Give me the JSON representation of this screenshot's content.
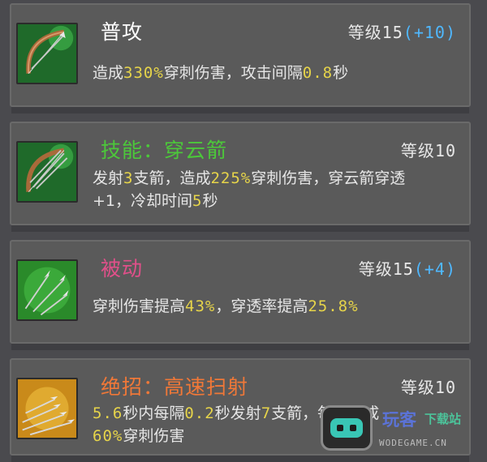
{
  "colors": {
    "card_bg": "#5a5a5a",
    "highlight_yellow": "#e6d44a",
    "bonus_blue": "#4fb8ff",
    "title_white": "#ffffff",
    "title_green": "#4cc83a",
    "title_pink": "#e0508a",
    "title_orange": "#f07838"
  },
  "skills": [
    {
      "icon": "bow-icon",
      "title": "普攻",
      "level_label": "等级15",
      "level_bonus": "(+10)",
      "desc": {
        "t1": "造成",
        "v1": "330%",
        "t2": "穿刺伤害，攻击间隔",
        "v2": "0.8",
        "t3": "秒"
      }
    },
    {
      "icon": "bow-icon",
      "title": "技能：穿云箭",
      "level_label": "等级10",
      "desc": {
        "t1": "发射",
        "v1": "3",
        "t2": "支箭，造成",
        "v2": "225%",
        "t3": "穿刺伤害，穿云箭穿透",
        "t4": "+1，冷却时间",
        "v3": "5",
        "t5": "秒"
      }
    },
    {
      "icon": "arrows-icon",
      "title": "被动",
      "level_label": "等级15",
      "level_bonus": "(+4)",
      "desc": {
        "t1": "穿刺伤害提高",
        "v1": "43%",
        "t2": "，穿透率提高",
        "v2": "25.8%"
      }
    },
    {
      "icon": "arrow-volley-icon",
      "title": "绝招：高速扫射",
      "level_label": "等级10",
      "desc": {
        "v1": "5.6",
        "t1": "秒内每隔",
        "v2": "0.2",
        "t2": "秒发射",
        "v3": "7",
        "t3": "支箭，每支造成",
        "v4": "60%",
        "t4": "穿刺伤害"
      }
    }
  ],
  "watermark": {
    "name": "玩客",
    "suffix": "下载站",
    "url": "WODEGAME.CN"
  }
}
